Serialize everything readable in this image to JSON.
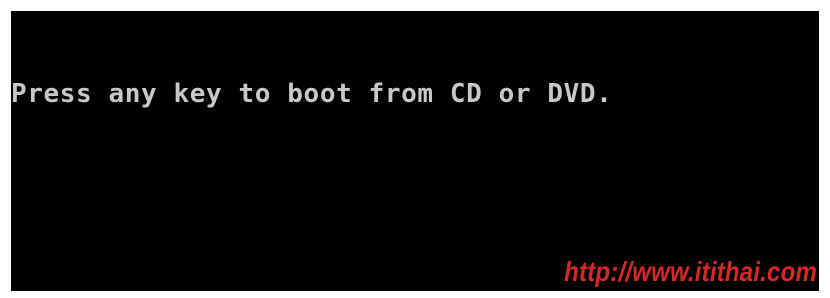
{
  "console": {
    "message": "Press any key to boot from CD or DVD.",
    "background_color": "#000000",
    "text_color": "#c8c8c8"
  },
  "watermark": {
    "text": "http://www.itithai.com",
    "color": "#d62828"
  }
}
